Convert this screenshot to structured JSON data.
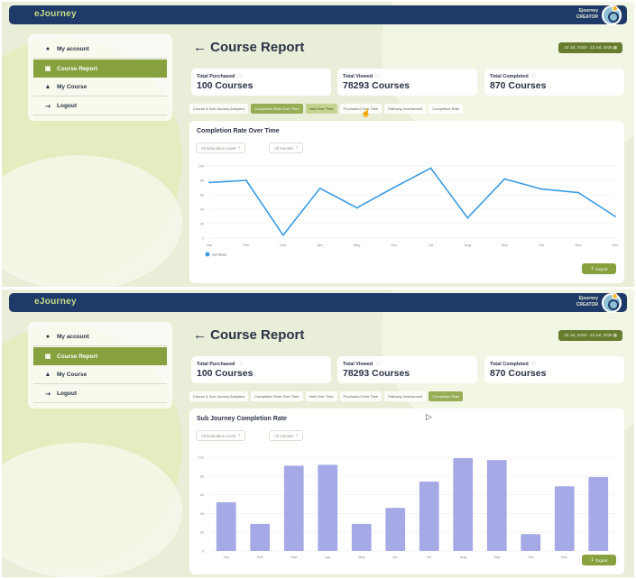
{
  "app": {
    "logo": "eJourney",
    "creator_line1": "Ejourney",
    "creator_line2": "CREATOR"
  },
  "sidebar": {
    "items": [
      {
        "label": "My account",
        "icon": "user-icon"
      },
      {
        "label": "Course Report",
        "icon": "report-icon",
        "active": true
      },
      {
        "label": "My Course",
        "icon": "graduation-cap-icon"
      },
      {
        "label": "Logout",
        "icon": "logout-icon"
      }
    ]
  },
  "page": {
    "title": "← Course Report",
    "date_range": "23 Jul, 2026 - 23 Jul, 2026"
  },
  "stats": [
    {
      "label": "Total Purchased",
      "value": "100 Courses"
    },
    {
      "label": "Total Viewed",
      "value": "78293 Courses"
    },
    {
      "label": "Total Completed",
      "value": "870 Courses"
    }
  ],
  "tabs": [
    "Course & Sub Journey Analytics",
    "Completion Rate Over Time",
    "Visit Over Time",
    "Purchased Over Time",
    "Pathway Involvement",
    "Completion Rate"
  ],
  "filters": {
    "education": "All Education Level",
    "gender": "All Gender"
  },
  "export_label": "Export",
  "colors": {
    "topbar": "#1f3a68",
    "accent": "#87a13f",
    "line": "#3a9be3",
    "bar": "#a5a9e6"
  },
  "screen1": {
    "active_tab": 1,
    "hover_tab": 2,
    "card_title": "Completion Rate Over Time",
    "chart_data": {
      "type": "line",
      "categories": [
        "Jan",
        "Feb",
        "Mar",
        "Apr",
        "May",
        "Jun",
        "Jul",
        "Aug",
        "Sep",
        "Oct",
        "Nov",
        "Dec"
      ],
      "series": [
        {
          "name": "Gentleas",
          "values": [
            77,
            80,
            4,
            69,
            42,
            70,
            97,
            28,
            82,
            68,
            63,
            30
          ]
        }
      ],
      "ylim": [
        0,
        100
      ],
      "yticks": [
        0,
        20,
        40,
        60,
        80,
        100
      ],
      "grid": true,
      "legend": "bottom-left"
    }
  },
  "screen2": {
    "active_tab": 5,
    "card_title": "Sub Journey Completion Rate",
    "chart_data": {
      "type": "bar",
      "categories": [
        "Jan",
        "Feb",
        "Mar",
        "Apr",
        "May",
        "Jun",
        "Jul",
        "Aug",
        "Sep",
        "Oct",
        "Nov",
        "Dec"
      ],
      "values": [
        52,
        29,
        91,
        92,
        29,
        46,
        74,
        99,
        97,
        18,
        69,
        79
      ],
      "ylim": [
        0,
        100
      ],
      "yticks": [
        0,
        20,
        40,
        60,
        80,
        100
      ],
      "grid": true
    }
  }
}
